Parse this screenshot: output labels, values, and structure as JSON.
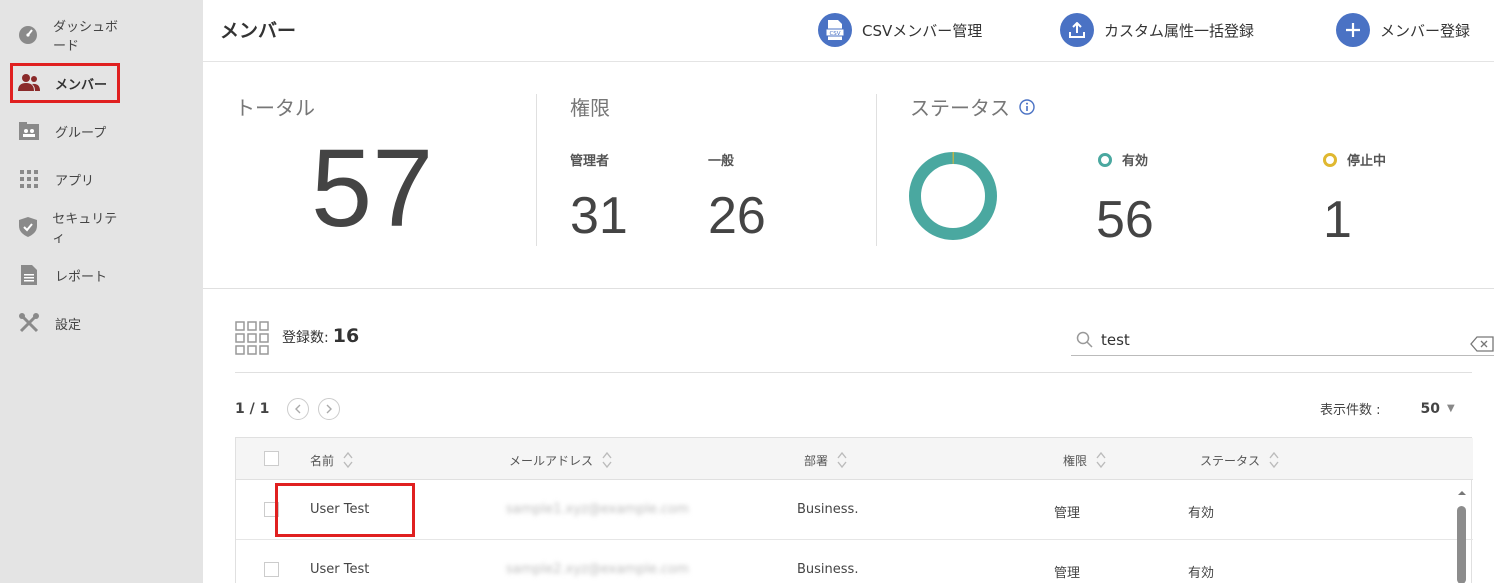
{
  "sidebar": {
    "items": [
      {
        "label": "ダッシュボード",
        "icon": "dashboard-icon"
      },
      {
        "label": "メンバー",
        "icon": "members-icon"
      },
      {
        "label": "グループ",
        "icon": "group-icon"
      },
      {
        "label": "アプリ",
        "icon": "apps-icon"
      },
      {
        "label": "セキュリティ",
        "icon": "shield-icon"
      },
      {
        "label": "レポート",
        "icon": "report-icon"
      },
      {
        "label": "設定",
        "icon": "tools-icon"
      }
    ]
  },
  "header": {
    "title": "メンバー",
    "actions": [
      {
        "label": "CSVメンバー管理",
        "icon": "csv-icon"
      },
      {
        "label": "カスタム属性一括登録",
        "icon": "upload-icon"
      },
      {
        "label": "メンバー登録",
        "icon": "plus-icon"
      }
    ]
  },
  "stats": {
    "total": {
      "label": "トータル",
      "value": "57"
    },
    "role": {
      "label": "権限",
      "admin_label": "管理者",
      "admin_value": "31",
      "general_label": "一般",
      "general_value": "26"
    },
    "status": {
      "label": "ステータス",
      "active_label": "有効",
      "active_value": "56",
      "suspended_label": "停止中",
      "suspended_value": "1",
      "active_color": "#4aa8a0",
      "suspended_color": "#e0b830"
    }
  },
  "list": {
    "count_label": "登録数:",
    "count_value": "16",
    "search_value": "test",
    "page": "1 / 1",
    "per_page_label": "表示件数 :",
    "per_page_value": "50",
    "columns": [
      "名前",
      "メールアドレス",
      "部署",
      "権限",
      "ステータス"
    ],
    "rows": [
      {
        "name": "User Test",
        "email": "sample1.xyz@example.com",
        "dept": "Business.",
        "role": "管理",
        "status": "有効"
      },
      {
        "name": "User Test",
        "email": "sample2.xyz@example.com",
        "dept": "Business.",
        "role": "管理",
        "status": "有効"
      }
    ]
  }
}
